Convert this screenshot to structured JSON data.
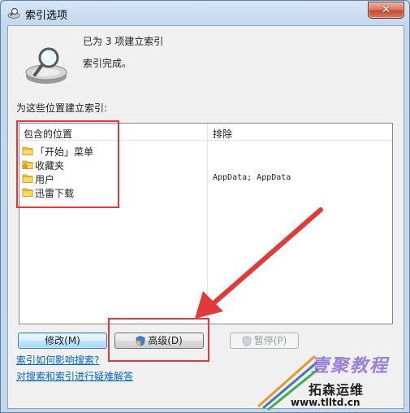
{
  "window": {
    "title": "索引选项",
    "close_glyph": "✕"
  },
  "status": {
    "indexed_count_text": "已为 3 项建立索引",
    "state_text": "索引完成。"
  },
  "locations_caption": "为这些位置建立索引:",
  "table": {
    "columns": [
      "包含的位置",
      "排除"
    ],
    "rows": [
      {
        "location": "「开始」菜单",
        "icon": "folder-icon",
        "exclusion": ""
      },
      {
        "location": "收藏夹",
        "icon": "favorites-folder-icon",
        "exclusion": ""
      },
      {
        "location": "用户",
        "icon": "folder-icon",
        "exclusion": "AppData; AppData"
      },
      {
        "location": "迅雷下载",
        "icon": "folder-icon",
        "exclusion": ""
      }
    ]
  },
  "buttons": {
    "modify": "修改(M)",
    "advanced": "高级(D)",
    "pause": "暂停(P)"
  },
  "links": {
    "how_indexing_affects": "索引如何影响搜索?",
    "troubleshoot": "对搜索和索引进行疑难解答"
  },
  "watermark": {
    "brand": "壹聚教程",
    "site_name": "拓森运维",
    "url": "www.tlltd.cn"
  },
  "colors": {
    "annotation_red": "#e03a3a",
    "link_blue": "#0066cc",
    "titlebar": "#c3d8ee"
  }
}
